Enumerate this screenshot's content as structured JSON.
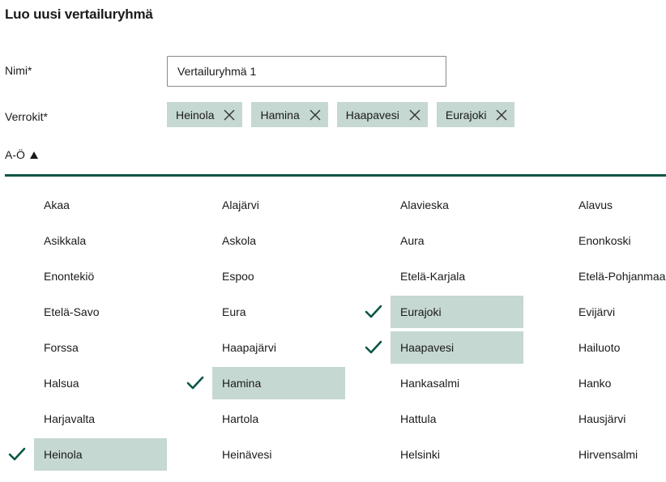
{
  "header": {
    "title": "Luo uusi vertailuryhmä"
  },
  "form": {
    "name_label": "Nimi*",
    "name_value": "Vertailuryhmä 1",
    "networks_label": "Verrokit*"
  },
  "selected_chips": [
    "Heinola",
    "Hamina",
    "Haapavesi",
    "Eurajoki"
  ],
  "sort": {
    "label": "A-Ö",
    "direction": "ascending"
  },
  "colors": {
    "accent": "#0b5647",
    "selected_bg": "#c5d8d1",
    "check": "#0b5647"
  },
  "list": {
    "columns": [
      [
        {
          "label": "Akaa",
          "selected": false
        },
        {
          "label": "Asikkala",
          "selected": false
        },
        {
          "label": "Enontekiö",
          "selected": false
        },
        {
          "label": "Etelä-Savo",
          "selected": false
        },
        {
          "label": "Forssa",
          "selected": false
        },
        {
          "label": "Halsua",
          "selected": false
        },
        {
          "label": "Harjavalta",
          "selected": false
        },
        {
          "label": "Heinola",
          "selected": true
        }
      ],
      [
        {
          "label": "Alajärvi",
          "selected": false
        },
        {
          "label": "Askola",
          "selected": false
        },
        {
          "label": "Espoo",
          "selected": false
        },
        {
          "label": "Eura",
          "selected": false
        },
        {
          "label": "Haapajärvi",
          "selected": false
        },
        {
          "label": "Hamina",
          "selected": true
        },
        {
          "label": "Hartola",
          "selected": false
        },
        {
          "label": "Heinävesi",
          "selected": false
        }
      ],
      [
        {
          "label": "Alavieska",
          "selected": false
        },
        {
          "label": "Aura",
          "selected": false
        },
        {
          "label": "Etelä-Karjala",
          "selected": false
        },
        {
          "label": "Eurajoki",
          "selected": true
        },
        {
          "label": "Haapavesi",
          "selected": true
        },
        {
          "label": "Hankasalmi",
          "selected": false
        },
        {
          "label": "Hattula",
          "selected": false
        },
        {
          "label": "Helsinki",
          "selected": false
        }
      ],
      [
        {
          "label": "Alavus",
          "selected": false
        },
        {
          "label": "Enonkoski",
          "selected": false
        },
        {
          "label": "Etelä-Pohjanmaa",
          "selected": false
        },
        {
          "label": "Evijärvi",
          "selected": false
        },
        {
          "label": "Hailuoto",
          "selected": false
        },
        {
          "label": "Hanko",
          "selected": false
        },
        {
          "label": "Hausjärvi",
          "selected": false
        },
        {
          "label": "Hirvensalmi",
          "selected": false
        }
      ]
    ]
  }
}
